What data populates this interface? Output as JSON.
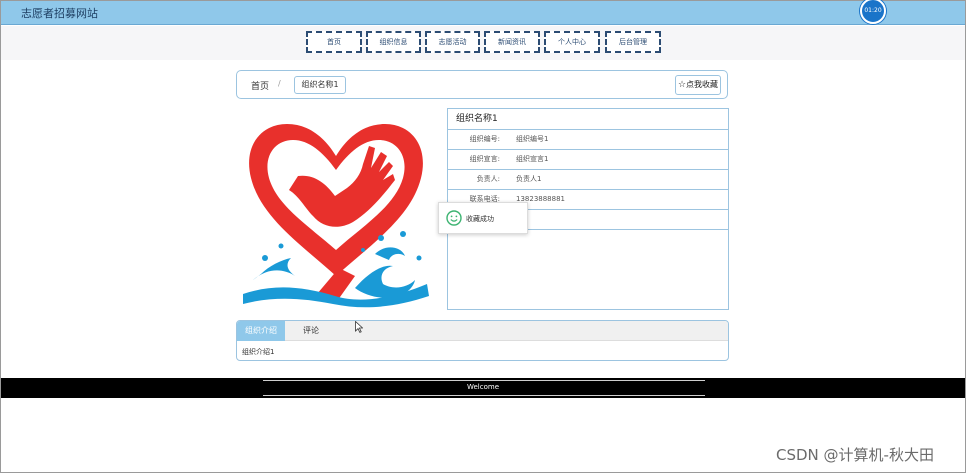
{
  "header": {
    "site_title": "志愿者招募网站",
    "clock_text": "01:20"
  },
  "nav": {
    "items": [
      {
        "label": "首页"
      },
      {
        "label": "组织信息"
      },
      {
        "label": "志愿活动"
      },
      {
        "label": "新闻资讯"
      },
      {
        "label": "个人中心"
      },
      {
        "label": "后台管理"
      }
    ]
  },
  "breadcrumb": {
    "home": "首页",
    "separator": "/",
    "current": "组织名称1"
  },
  "favorite": {
    "label": "点我收藏"
  },
  "info": {
    "title": "组织名称1",
    "rows": [
      {
        "key": "组织编号:",
        "value": "组织编号1"
      },
      {
        "key": "组织宣言:",
        "value": "组织宣言1"
      },
      {
        "key": "负责人:",
        "value": "负责人1"
      },
      {
        "key": "联系电话:",
        "value": "13823888881"
      },
      {
        "key": "",
        "value": ""
      }
    ]
  },
  "toast": {
    "text": "收藏成功"
  },
  "tabs": {
    "items": [
      {
        "label": "组织介绍"
      },
      {
        "label": "评论"
      }
    ],
    "content": "组织介绍1"
  },
  "footer": {
    "text": "Welcome"
  },
  "watermark": {
    "text": "CSDN @计算机-秋大田"
  },
  "colors": {
    "accent": "#8fc8ea",
    "nav_border": "#2c4c73",
    "logo_red": "#e8302c",
    "logo_blue": "#1a9ad6"
  }
}
